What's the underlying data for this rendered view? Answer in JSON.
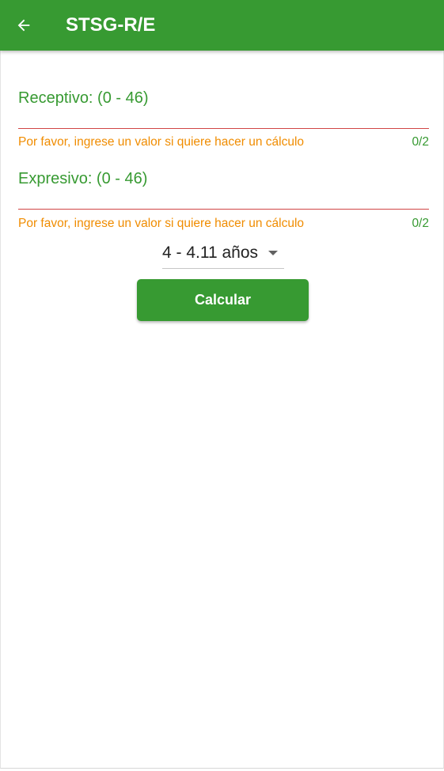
{
  "app_bar": {
    "title": "STSG-R/E",
    "back_icon": "arrow-left-icon",
    "color": "#379a32"
  },
  "form": {
    "receptivo": {
      "label": "Receptivo:  (0 - 46)",
      "value": "",
      "error": "Por favor, ingrese un valor si quiere hacer un cálculo",
      "counter": "0/2"
    },
    "expresivo": {
      "label": "Expresivo:  (0 - 46)",
      "value": "",
      "error": "Por favor, ingrese un valor si quiere hacer un cálculo",
      "counter": "0/2"
    },
    "age_select": {
      "selected": "4 - 4.11 años",
      "icon": "caret-down-icon"
    },
    "calculate_label": "Calcular"
  },
  "colors": {
    "primary": "#379a32",
    "error_line": "#d04545",
    "helper_text": "#f08c00"
  }
}
